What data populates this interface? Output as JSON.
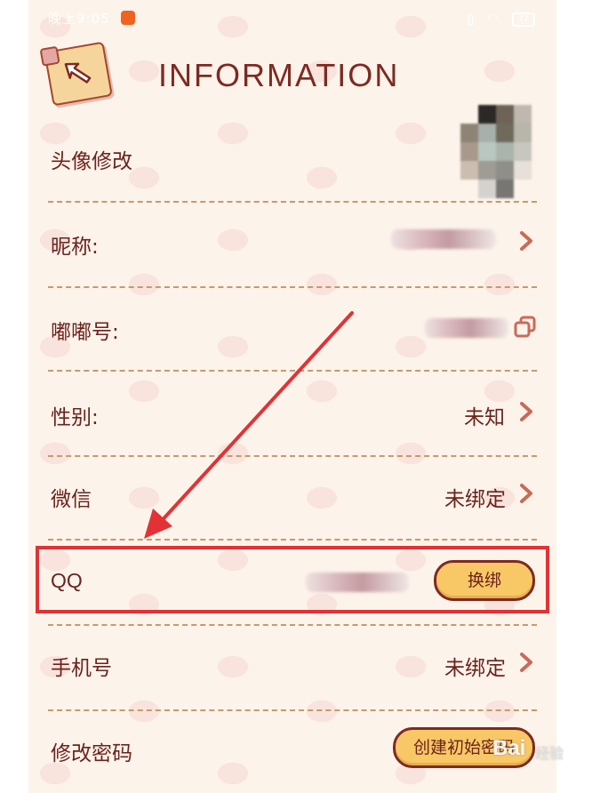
{
  "status_bar": {
    "time": "晚上9:05",
    "battery": "77"
  },
  "header": {
    "title": "INFORMATION",
    "back_icon": "back-arrow-icon"
  },
  "rows": {
    "avatar": {
      "label": "头像修改"
    },
    "nickname": {
      "label": "昵称:"
    },
    "dudu_id": {
      "label": "嘟嘟号:"
    },
    "gender": {
      "label": "性别:",
      "value": "未知"
    },
    "wechat": {
      "label": "微信",
      "value": "未绑定"
    },
    "qq": {
      "label": "QQ",
      "button": "换绑"
    },
    "phone": {
      "label": "手机号",
      "value": "未绑定"
    },
    "password": {
      "label": "修改密码",
      "button": "创建初始密码"
    }
  },
  "colors": {
    "background": "#fcf3ea",
    "text": "#6b231c",
    "accent_button": "#f8c766",
    "highlight": "#e23236"
  },
  "watermark": {
    "brand": "Bai",
    "sub": "经验"
  }
}
